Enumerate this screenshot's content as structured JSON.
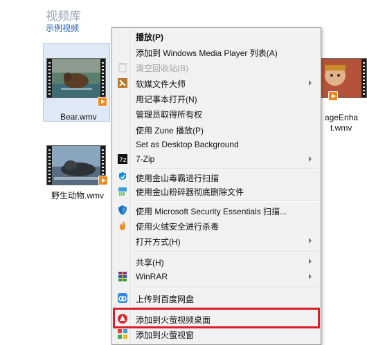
{
  "library": {
    "title": "视频库",
    "subtitle": "示例视频"
  },
  "files": [
    {
      "name": "Bear.wmv",
      "selected": true
    },
    {
      "name": "野生动物.wmv",
      "selected": false
    },
    {
      "name_line1": "ageEnha",
      "name_line2": "t.wmv",
      "selected": false
    }
  ],
  "context_menu": {
    "items": [
      {
        "id": "play",
        "label": "播放(P)",
        "bold": true
      },
      {
        "id": "add-to-wmp",
        "label": "添加到 Windows Media Player 列表(A)"
      },
      {
        "id": "empty-recycle",
        "label": "清空回收站(B)",
        "disabled": true,
        "icon": "recycle-bin-icon"
      },
      {
        "id": "softmedia",
        "label": "软媒文件大师",
        "submenu": true,
        "icon": "file-master-icon"
      },
      {
        "id": "notepad",
        "label": "用记事本打开(N)"
      },
      {
        "id": "take-ownership",
        "label": "管理员取得所有权"
      },
      {
        "id": "zune-play",
        "label": "使用 Zune 播放(P)"
      },
      {
        "id": "set-desktop-bg",
        "label": "Set as Desktop Background"
      },
      {
        "id": "7zip",
        "label": "7-Zip",
        "submenu": true,
        "icon": "7zip-icon"
      },
      {
        "id": "kingsoft-scan",
        "label": "使用金山毒霸进行扫描",
        "icon": "kingsoft-antivirus-icon"
      },
      {
        "id": "kingsoft-shred",
        "label": "使用金山粉碎器彻底删除文件",
        "icon": "shredder-icon"
      },
      {
        "id": "mse-scan",
        "label": "使用 Microsoft Security Essentials 扫描...",
        "icon": "mse-shield-icon"
      },
      {
        "id": "huorong-scan",
        "label": "使用火绒安全进行杀毒",
        "icon": "huorong-flame-icon"
      },
      {
        "id": "open-with",
        "label": "打开方式(H)",
        "submenu": true
      },
      {
        "id": "share",
        "label": "共享(H)",
        "submenu": true
      },
      {
        "id": "winrar",
        "label": "WinRAR",
        "submenu": true,
        "icon": "winrar-icon"
      },
      {
        "id": "baidu-upload",
        "label": "上传到百度网盘",
        "icon": "baidu-cloud-icon"
      },
      {
        "id": "firefly-desktop",
        "label": "添加到火萤视频桌面",
        "icon": "firefly-icon"
      },
      {
        "id": "firefly-window",
        "label": "添加到火萤视窗",
        "icon": "firefly-window-icon"
      }
    ]
  },
  "colors": {
    "menu_bg": "#f1f1f1",
    "highlight_border": "#d92027",
    "play_badge": "#eb8a21",
    "subtitle_link": "#1e5fa8"
  }
}
